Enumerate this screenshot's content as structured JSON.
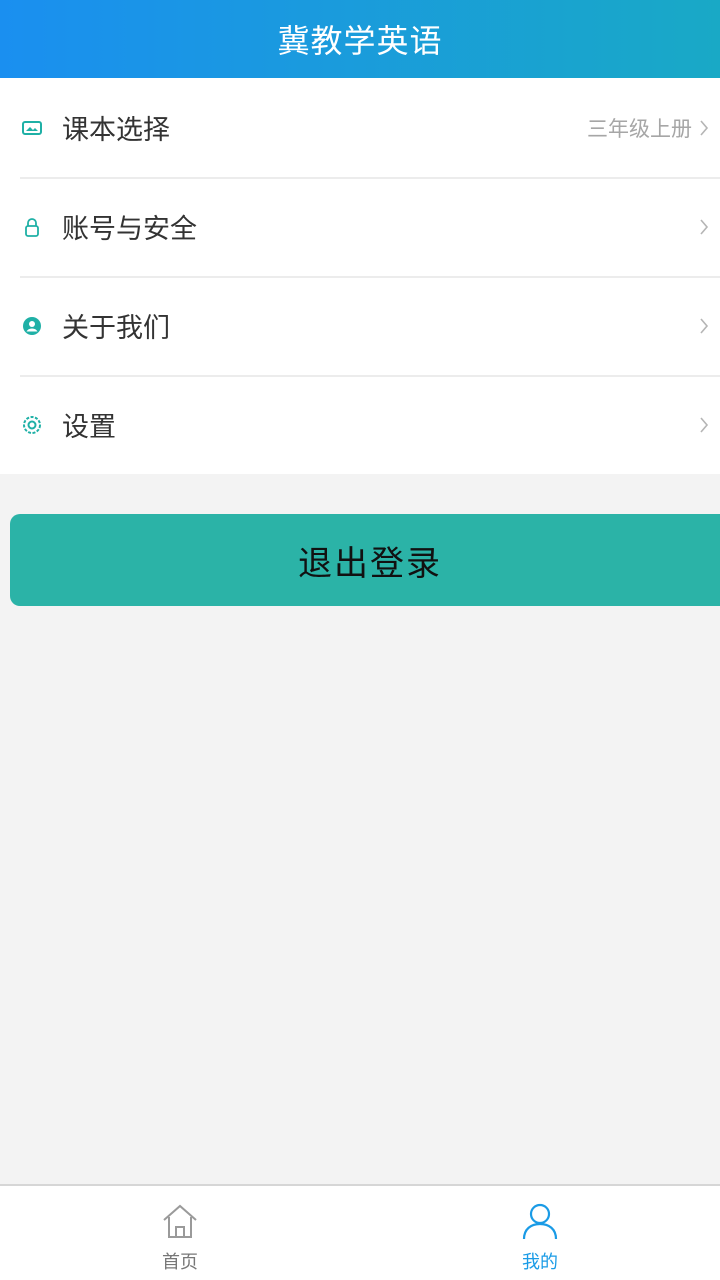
{
  "header": {
    "title": "冀教学英语"
  },
  "menu": {
    "items": [
      {
        "label": "课本选择",
        "value": "三年级上册",
        "icon": "textbook-icon"
      },
      {
        "label": "账号与安全",
        "value": "",
        "icon": "lock-icon"
      },
      {
        "label": "关于我们",
        "value": "",
        "icon": "user-circle-icon"
      },
      {
        "label": "设置",
        "value": "",
        "icon": "gear-icon"
      }
    ]
  },
  "logout": {
    "label": "退出登录"
  },
  "tabbar": {
    "tabs": [
      {
        "label": "首页",
        "icon": "home-icon",
        "active": false
      },
      {
        "label": "我的",
        "icon": "person-icon",
        "active": true
      }
    ]
  },
  "colors": {
    "header_start": "#1a8ff0",
    "header_end": "#19a9c6",
    "accent_teal": "#2bb3a7",
    "icon_teal": "#1fb0a6",
    "active_tab": "#1a9be6",
    "background": "#f3f3f3"
  }
}
